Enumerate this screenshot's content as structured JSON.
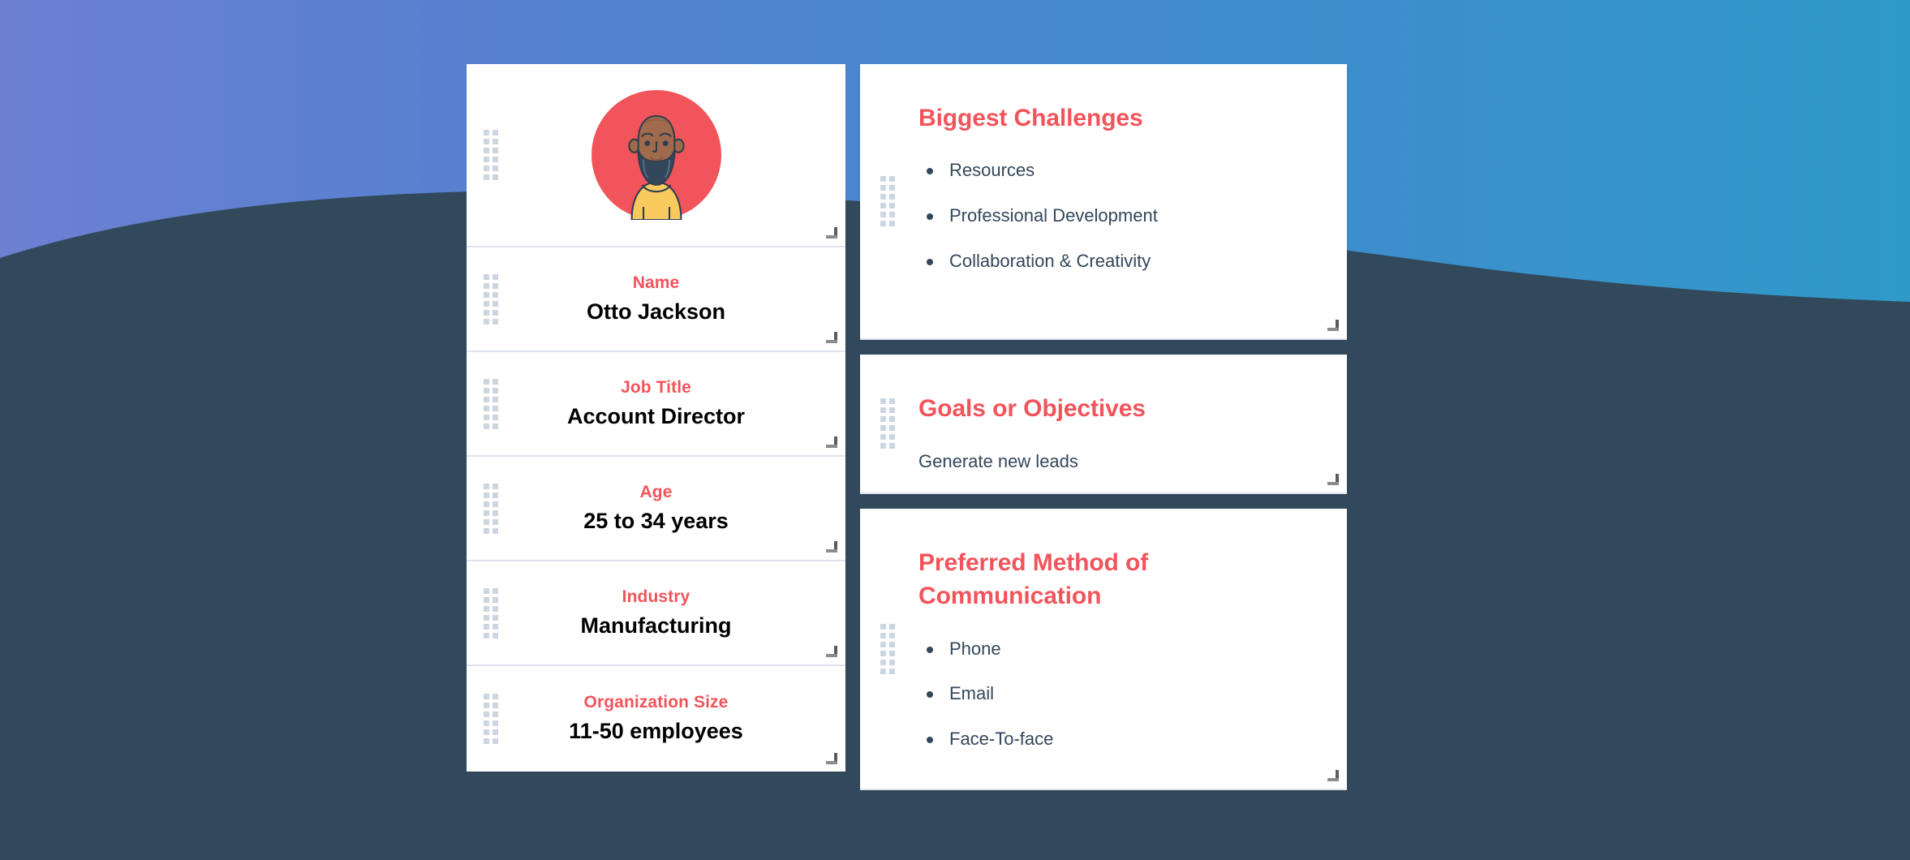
{
  "theme": {
    "accent_red": "#f2545b",
    "text_dark": "#33475b",
    "value_black": "#000000",
    "card_bg": "#ffffff",
    "divider": "#dfe3eb",
    "handle_dot": "#cbd6e2",
    "bg_purple": "#6b7fd0",
    "bg_blue": "#4a86d1",
    "bg_teal": "#3498c8",
    "bg_slate": "#32495c",
    "avatar_circle": "#f2545b",
    "avatar_skin": "#a06a4d",
    "avatar_beard": "#33475b",
    "avatar_shirt": "#f8c95d"
  },
  "profile": {
    "avatar_icon": "bearded-man-avatar",
    "fields": [
      {
        "label": "Name",
        "value": "Otto Jackson"
      },
      {
        "label": "Job Title",
        "value": "Account Director"
      },
      {
        "label": "Age",
        "value": "25 to 34 years"
      },
      {
        "label": "Industry",
        "value": "Manufacturing"
      },
      {
        "label": "Organization Size",
        "value": "11-50 employees"
      }
    ]
  },
  "panels": {
    "challenges": {
      "title": "Biggest Challenges",
      "items": [
        "Resources",
        "Professional Development",
        "Collaboration & Creativity"
      ]
    },
    "goals": {
      "title": "Goals or Objectives",
      "text": "Generate new leads"
    },
    "communication": {
      "title": "Preferred Method of Communication",
      "items": [
        "Phone",
        "Email",
        "Face-To-face"
      ]
    }
  },
  "controls": {
    "drag_handle_icon": "drag-dots-icon",
    "resize_handle_icon": "resize-corner-icon"
  }
}
